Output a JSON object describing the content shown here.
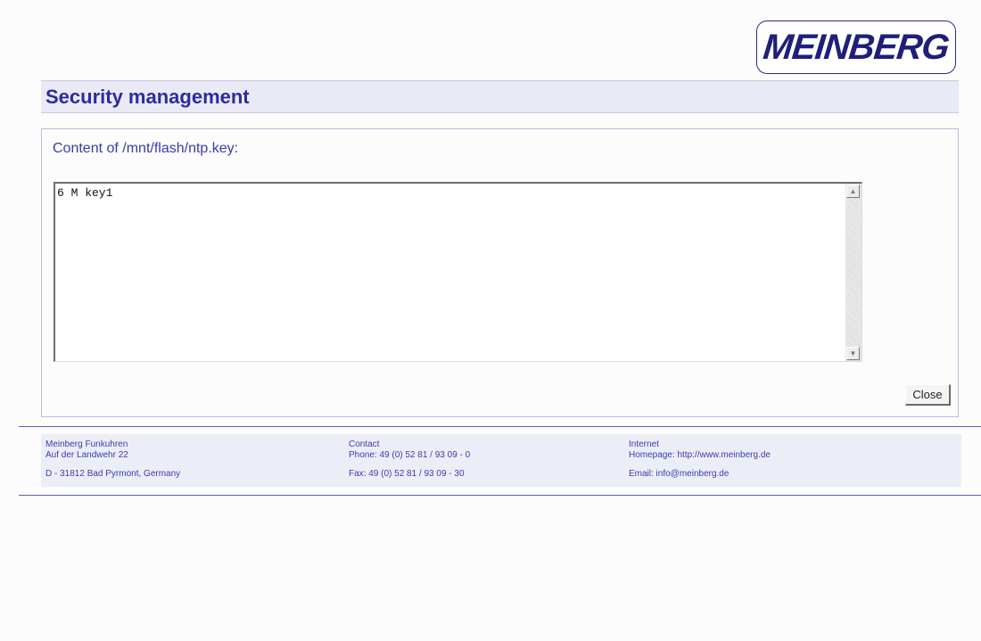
{
  "header": {
    "logo_text": "MEINBERG",
    "page_title": "Security management"
  },
  "content": {
    "heading": "Content of /mnt/flash/ntp.key:",
    "file_text": "6 M key1",
    "close_label": "Close"
  },
  "footer": {
    "company": {
      "name": "Meinberg Funkuhren",
      "street": "Auf der Landwehr 22",
      "city": "D - 31812 Bad Pyrmont, Germany"
    },
    "contact": {
      "heading": "Contact",
      "phone": "Phone: 49 (0) 52 81 / 93 09 - 0",
      "fax": "Fax: 49 (0) 52 81 / 93 09 - 30"
    },
    "internet": {
      "heading": "Internet",
      "homepage": "Homepage: http://www.meinberg.de",
      "email": "Email: info@meinberg.de"
    }
  },
  "icons": {
    "scroll_up": "scroll-up-arrow-icon",
    "scroll_down": "scroll-down-arrow-icon"
  },
  "colors": {
    "accent": "#2d2d9c",
    "title_bar": "#e9eaf6",
    "footer_bg": "#eceef7",
    "rule": "#5f61b0"
  }
}
